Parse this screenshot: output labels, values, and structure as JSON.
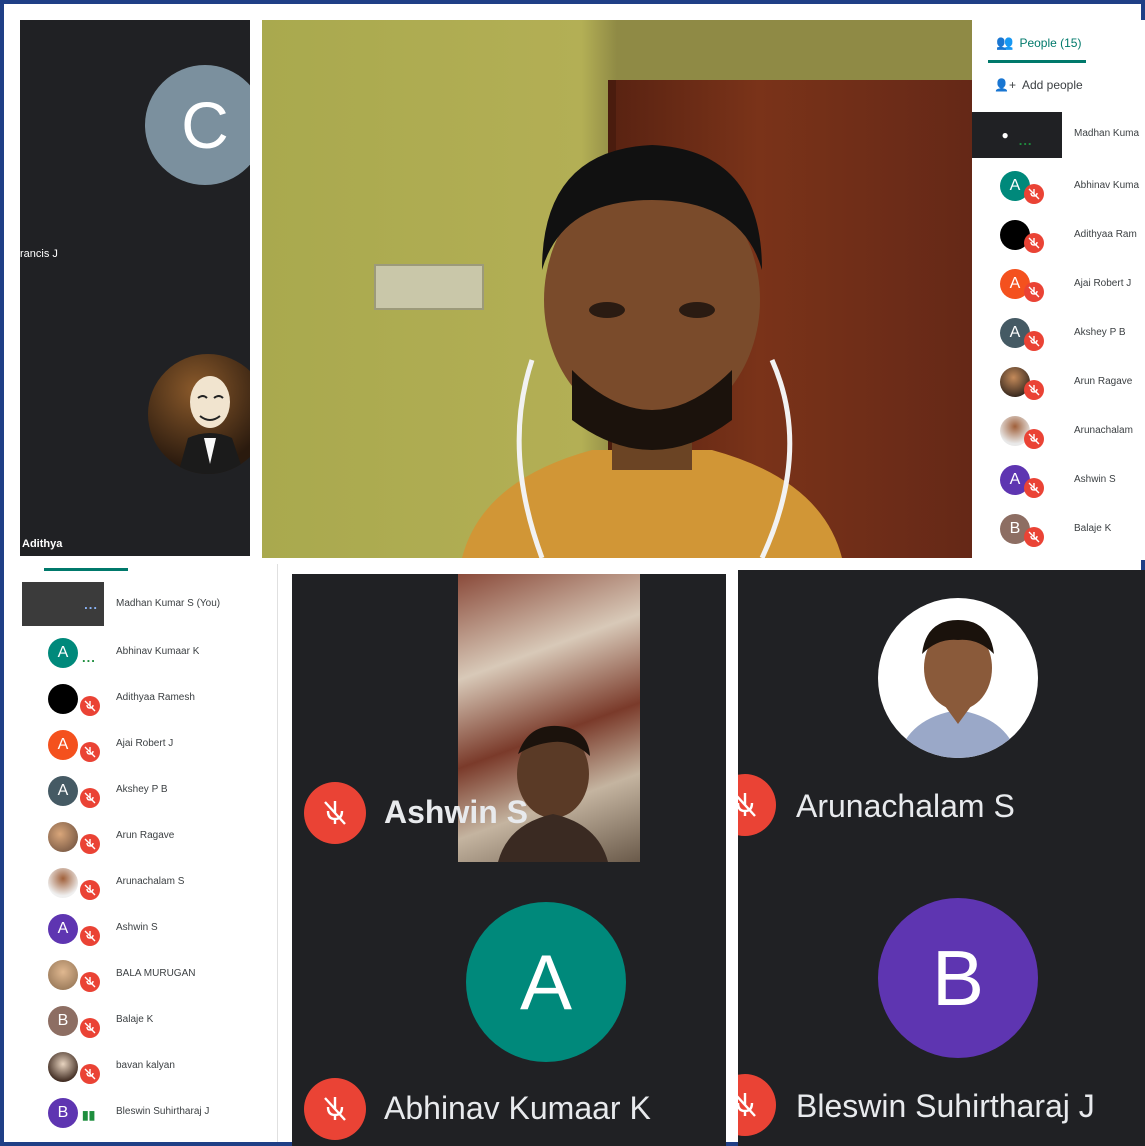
{
  "top_left": {
    "avatar_letter": "C",
    "name_1": "rancis J",
    "name_2": "Adithya"
  },
  "people_panel": {
    "tab_label": "People (15)",
    "add_people": "Add people",
    "items": [
      {
        "name": "Madhan Kuma",
        "avatar": "pin",
        "color": "#202124"
      },
      {
        "name": "Abhinav Kuma",
        "avatar": "A",
        "color": "#00897b"
      },
      {
        "name": "Adithyaa Ram",
        "avatar": "",
        "color": "#000000"
      },
      {
        "name": "Ajai Robert J",
        "avatar": "A",
        "color": "#f4511e"
      },
      {
        "name": "Akshey P B",
        "avatar": "A",
        "color": "#455a64"
      },
      {
        "name": "Arun Ragave",
        "avatar": "photo",
        "color": "#6d5a4a"
      },
      {
        "name": "Arunachalam",
        "avatar": "photo",
        "color": "#8a6a55"
      },
      {
        "name": "Ashwin S",
        "avatar": "A",
        "color": "#5e35b1"
      },
      {
        "name": "Balaje K",
        "avatar": "B",
        "color": "#8d6e63"
      }
    ]
  },
  "left_list": {
    "items": [
      {
        "name": "Madhan Kumar S (You)",
        "avatar": "video",
        "color": "#4a4a4a"
      },
      {
        "name": "Abhinav Kumaar K",
        "avatar": "A",
        "color": "#00897b"
      },
      {
        "name": "Adithyaa Ramesh",
        "avatar": "",
        "color": "#000000"
      },
      {
        "name": "Ajai Robert J",
        "avatar": "A",
        "color": "#f4511e"
      },
      {
        "name": "Akshey P B",
        "avatar": "A",
        "color": "#455a64"
      },
      {
        "name": "Arun Ragave",
        "avatar": "photo",
        "color": "#b08a6a"
      },
      {
        "name": "Arunachalam S",
        "avatar": "photo",
        "color": "#8a6a55"
      },
      {
        "name": "Ashwin S",
        "avatar": "A",
        "color": "#5e35b1"
      },
      {
        "name": "BALA MURUGAN",
        "avatar": "photo",
        "color": "#c9a27f"
      },
      {
        "name": "Balaje K",
        "avatar": "B",
        "color": "#8d6e63"
      },
      {
        "name": "bavan kalyan",
        "avatar": "photo",
        "color": "#5d4037"
      },
      {
        "name": "Bleswin Suhirtharaj J",
        "avatar": "B",
        "color": "#5e35b1"
      }
    ]
  },
  "tiles": {
    "ashwin": "Ashwin S",
    "abhinav": "Abhinav Kumaar K",
    "abhinav_letter": "A",
    "arunachalam": "Arunachalam S",
    "bleswin": "Bleswin Suhirtharaj J",
    "bleswin_letter": "B"
  },
  "colors": {
    "accent_green": "#00796b",
    "mic_red": "#ea4335",
    "tile_bg": "#202124"
  }
}
